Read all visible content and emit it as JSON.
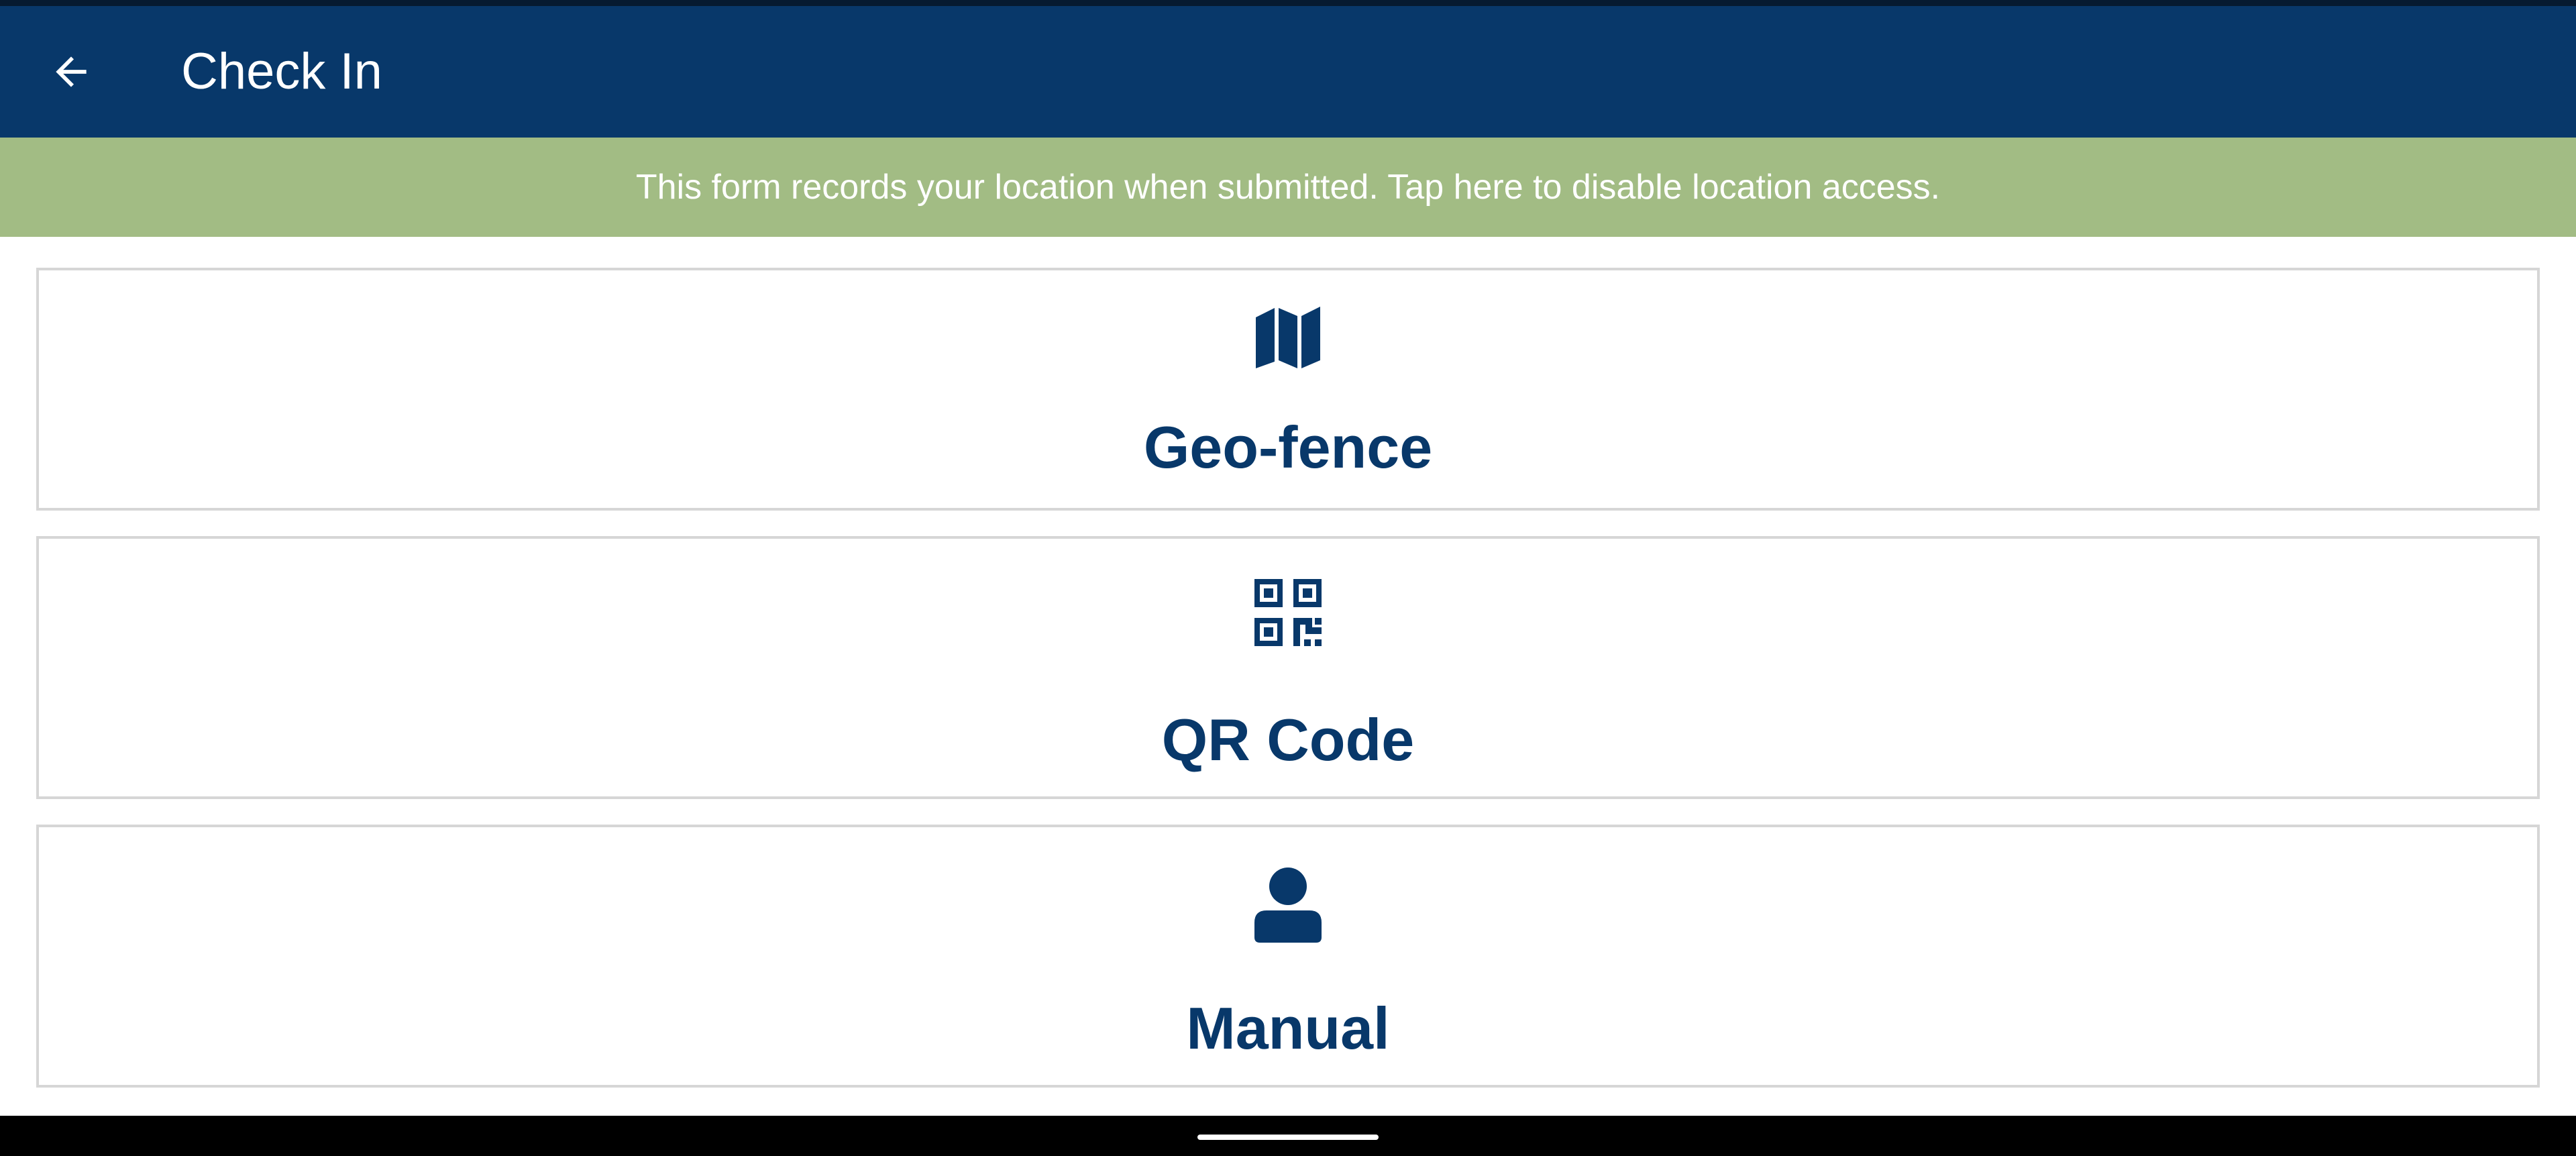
{
  "colors": {
    "primary": "#08386a",
    "banner": "#a2bc84",
    "status_strip": "#061a30",
    "card_border": "#d6d6d6",
    "nav_bar": "#000000"
  },
  "app_bar": {
    "title": "Check In",
    "back_icon": "arrow-left-icon"
  },
  "banner": {
    "text": "This form records your location when submitted. Tap here to disable location access."
  },
  "options": [
    {
      "label": "Geo-fence",
      "icon": "map-icon"
    },
    {
      "label": "QR Code",
      "icon": "qr-code-icon"
    },
    {
      "label": "Manual",
      "icon": "user-icon"
    }
  ]
}
